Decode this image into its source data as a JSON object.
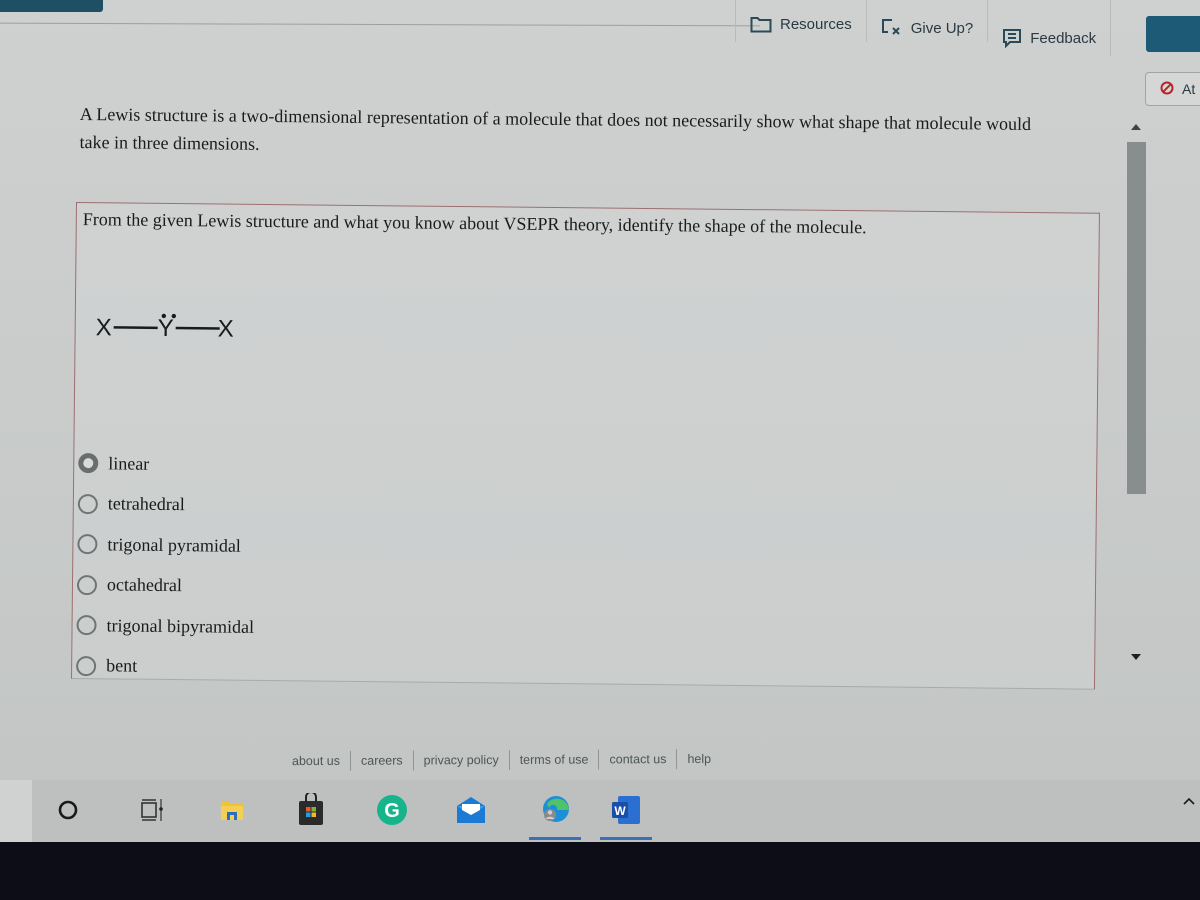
{
  "toolbar": {
    "resources_label": "Resources",
    "give_up_label": "Give Up?",
    "feedback_label": "Feedback",
    "attempt_label": "At"
  },
  "intro": {
    "text": "A Lewis structure is a two-dimensional representation of a molecule that does not necessarily show what shape that molecule would take in three dimensions."
  },
  "question": {
    "prompt": "From the given Lewis structure and what you know about VSEPR theory, identify the shape of the molecule.",
    "lewis_structure": {
      "left_atom": "X",
      "central_atom": "Y",
      "right_atom": "X",
      "central_lone_pairs": 1
    },
    "options": [
      {
        "label": "linear",
        "selected": true
      },
      {
        "label": "tetrahedral",
        "selected": false
      },
      {
        "label": "trigonal pyramidal",
        "selected": false
      },
      {
        "label": "octahedral",
        "selected": false
      },
      {
        "label": "trigonal bipyramidal",
        "selected": false
      },
      {
        "label": "bent",
        "selected": false
      }
    ]
  },
  "footer": {
    "links": [
      "about us",
      "careers",
      "privacy policy",
      "terms of use",
      "contact us",
      "help"
    ]
  },
  "taskbar": {
    "icons": [
      "search-icon",
      "task-view-icon",
      "file-explorer-icon",
      "microsoft-store-icon",
      "grammarly-icon",
      "mail-icon",
      "edge-icon",
      "word-icon"
    ],
    "word_letter": "W",
    "grammarly_letter": "G"
  },
  "colors": {
    "brand_blue": "#1d5a75",
    "taskbar_active": "#3b6fb6",
    "box_border": "#9b6f72"
  }
}
